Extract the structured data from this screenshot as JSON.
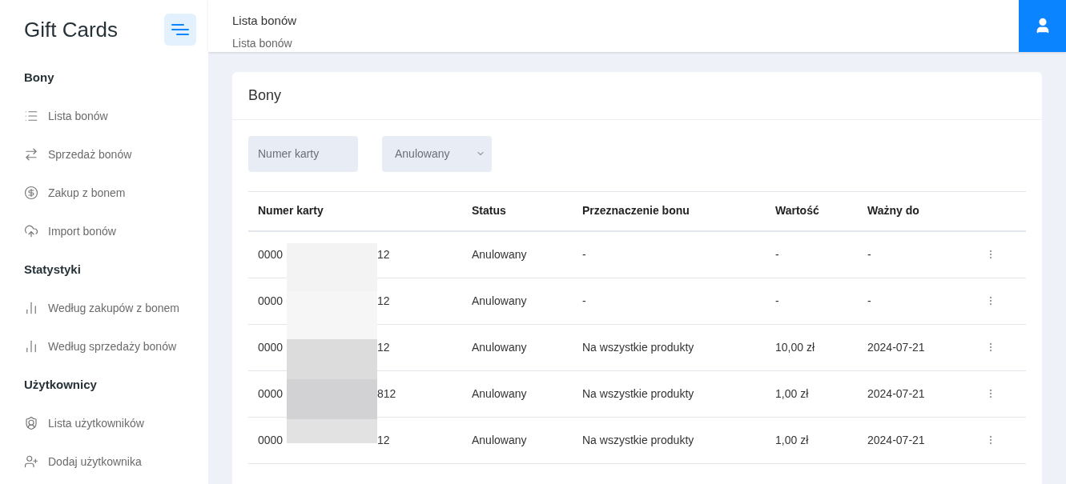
{
  "sidebar": {
    "title": "Gift Cards",
    "sections": [
      {
        "heading": "Bony",
        "items": [
          {
            "label": "Lista bonów"
          },
          {
            "label": "Sprzedaż bonów"
          },
          {
            "label": "Zakup z bonem"
          },
          {
            "label": "Import bonów"
          }
        ]
      },
      {
        "heading": "Statystyki",
        "items": [
          {
            "label": "Według zakupów z bonem"
          },
          {
            "label": "Według sprzedaży bonów"
          }
        ]
      },
      {
        "heading": "Użytkownicy",
        "items": [
          {
            "label": "Lista użytkowników"
          },
          {
            "label": "Dodaj użytkownika"
          }
        ]
      }
    ]
  },
  "header": {
    "title": "Lista bonów",
    "breadcrumb": "Lista bonów"
  },
  "card": {
    "title": "Bony",
    "filters": {
      "search": {
        "placeholder": "Numer karty"
      },
      "status": {
        "value": "Anulowany"
      }
    },
    "table": {
      "columns": [
        "Numer karty",
        "Status",
        "Przeznaczenie bonu",
        "Wartość",
        "Ważny do"
      ],
      "rows": [
        {
          "card_start": "0000",
          "card_end": "12",
          "status": "Anulowany",
          "purpose": "-",
          "value": "-",
          "valid_to": "-"
        },
        {
          "card_start": "0000",
          "card_end": "12",
          "status": "Anulowany",
          "purpose": "-",
          "value": "-",
          "valid_to": "-"
        },
        {
          "card_start": "0000",
          "card_end": "12",
          "status": "Anulowany",
          "purpose": "Na wszystkie produkty",
          "value": "10,00 zł",
          "valid_to": "2024-07-21"
        },
        {
          "card_start": "0000",
          "card_end": "812",
          "status": "Anulowany",
          "purpose": "Na wszystkie produkty",
          "value": "1,00 zł",
          "valid_to": "2024-07-21"
        },
        {
          "card_start": "0000",
          "card_end": "12",
          "status": "Anulowany",
          "purpose": "Na wszystkie produkty",
          "value": "1,00 zł",
          "valid_to": "2024-07-21"
        }
      ]
    }
  }
}
